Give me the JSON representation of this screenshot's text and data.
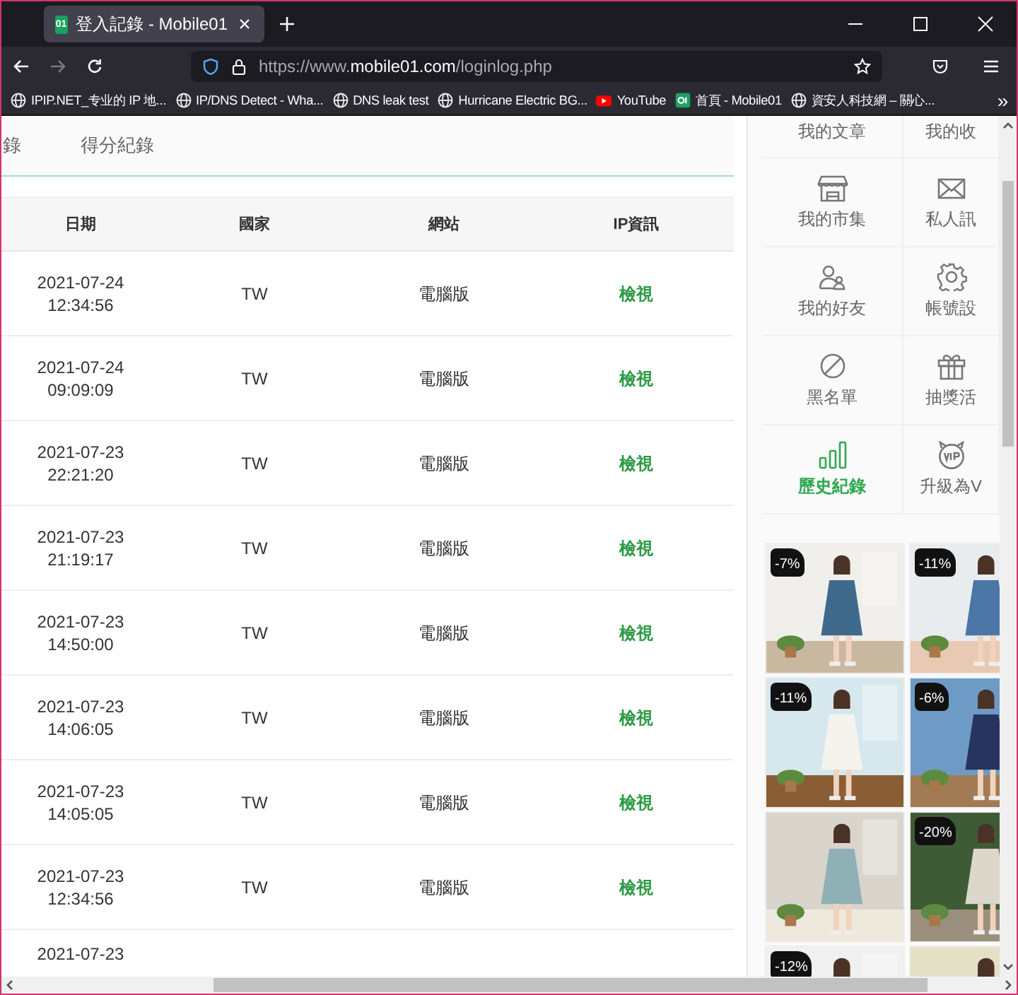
{
  "browser": {
    "tab_title": "登入記錄 - Mobile01",
    "tab_icon_text": "01",
    "url": {
      "scheme": "https://www.",
      "domain": "mobile01.com",
      "path": "/loginlog.php"
    },
    "bookmarks": [
      {
        "label": "IPIP.NET_专业的 IP 地...",
        "kind": "globe"
      },
      {
        "label": "IP/DNS Detect - Wha...",
        "kind": "globe"
      },
      {
        "label": "DNS leak test",
        "kind": "globe"
      },
      {
        "label": "Hurricane Electric BG...",
        "kind": "globe"
      },
      {
        "label": "YouTube",
        "kind": "youtube"
      },
      {
        "label": "首頁 - Mobile01",
        "kind": "mobile01"
      },
      {
        "label": "資安人科技網 – 關心...",
        "kind": "globe"
      }
    ],
    "overflow_label": "»"
  },
  "tabs": [
    {
      "label": "錄"
    },
    {
      "label": "得分紀錄"
    }
  ],
  "table": {
    "columns": [
      "日期",
      "國家",
      "網站",
      "IP資訊"
    ],
    "rows": [
      {
        "date": "2021-07-24",
        "time": "12:34:56",
        "country": "TW",
        "site": "電腦版",
        "ip": "檢視"
      },
      {
        "date": "2021-07-24",
        "time": "09:09:09",
        "country": "TW",
        "site": "電腦版",
        "ip": "檢視"
      },
      {
        "date": "2021-07-23",
        "time": "22:21:20",
        "country": "TW",
        "site": "電腦版",
        "ip": "檢視"
      },
      {
        "date": "2021-07-23",
        "time": "21:19:17",
        "country": "TW",
        "site": "電腦版",
        "ip": "檢視"
      },
      {
        "date": "2021-07-23",
        "time": "14:50:00",
        "country": "TW",
        "site": "電腦版",
        "ip": "檢視"
      },
      {
        "date": "2021-07-23",
        "time": "14:06:05",
        "country": "TW",
        "site": "電腦版",
        "ip": "檢視"
      },
      {
        "date": "2021-07-23",
        "time": "14:05:05",
        "country": "TW",
        "site": "電腦版",
        "ip": "檢視"
      },
      {
        "date": "2021-07-23",
        "time": "12:34:56",
        "country": "TW",
        "site": "電腦版",
        "ip": "檢視"
      },
      {
        "date": "2021-07-23"
      }
    ]
  },
  "sidebar": {
    "items": [
      {
        "label": "我的文章",
        "kind": "text",
        "selected": false
      },
      {
        "label": "我的收",
        "kind": "text",
        "selected": false
      },
      {
        "label": "我的市集",
        "kind": "store",
        "selected": false
      },
      {
        "label": "私人訊",
        "kind": "mail",
        "selected": false
      },
      {
        "label": "我的好友",
        "kind": "friends",
        "selected": false
      },
      {
        "label": "帳號設",
        "kind": "gear",
        "selected": false
      },
      {
        "label": "黑名單",
        "kind": "ban",
        "selected": false
      },
      {
        "label": "抽獎活",
        "kind": "gift",
        "selected": false
      },
      {
        "label": "歷史紀錄",
        "kind": "bars",
        "selected": true
      },
      {
        "label": "升級為V",
        "kind": "vip",
        "selected": false
      }
    ],
    "products": [
      {
        "kind": "picture",
        "badge": "-7%"
      },
      {
        "kind": "picture",
        "badge": "-11%"
      },
      {
        "kind": "picture",
        "badge": "-11%"
      },
      {
        "kind": "picture",
        "badge": "-6%"
      },
      {
        "kind": "picture"
      },
      {
        "kind": "picture",
        "badge": "-20%"
      },
      {
        "kind": "picture",
        "badge": "-12%"
      },
      {
        "kind": "picture"
      }
    ]
  }
}
